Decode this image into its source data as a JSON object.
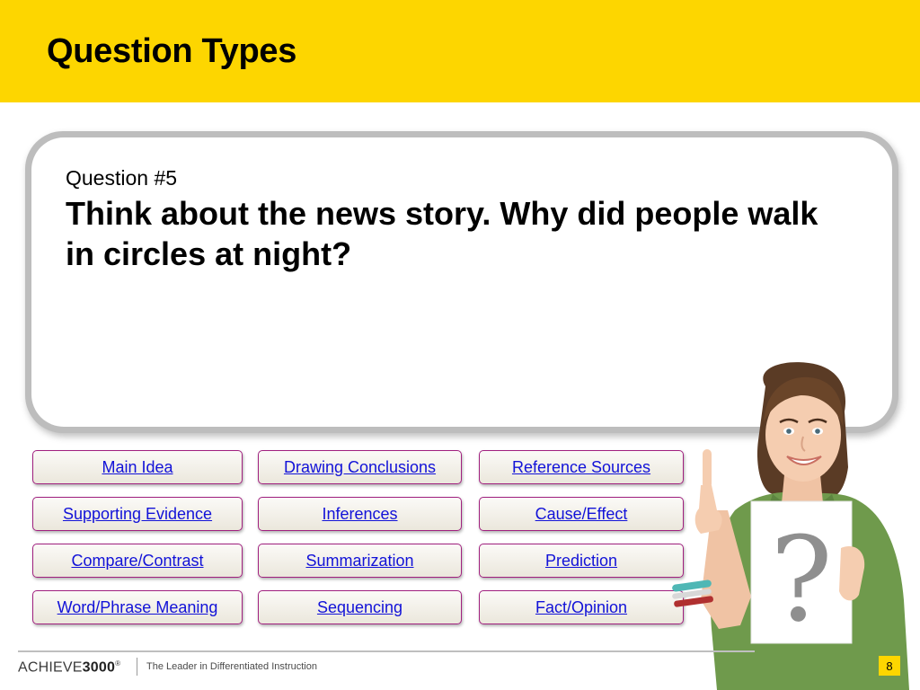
{
  "slide": {
    "title": "Question Types"
  },
  "question": {
    "number": "Question #5",
    "text": "Think about the news story. Why did people walk in circles at night?"
  },
  "question_types": [
    {
      "label": "Main Idea"
    },
    {
      "label": "Drawing Conclusions"
    },
    {
      "label": "Reference Sources"
    },
    {
      "label": "Supporting Evidence"
    },
    {
      "label": "Inferences"
    },
    {
      "label": "Cause/Effect"
    },
    {
      "label": "Compare/Contrast"
    },
    {
      "label": "Summarization"
    },
    {
      "label": "Prediction"
    },
    {
      "label": "Word/Phrase Meaning"
    },
    {
      "label": "Sequencing"
    },
    {
      "label": "Fact/Opinion"
    }
  ],
  "sign": {
    "glyph": "?"
  },
  "footer": {
    "brand_light": "ACHIEVE",
    "brand_bold": "3000",
    "brand_mark": "®",
    "tagline": "The Leader in Differentiated Instruction",
    "page_number": "8"
  },
  "colors": {
    "header_yellow": "#fdd600",
    "link_blue": "#1212d8",
    "button_border": "#a0207f",
    "shirt_green": "#6f9a4c"
  }
}
